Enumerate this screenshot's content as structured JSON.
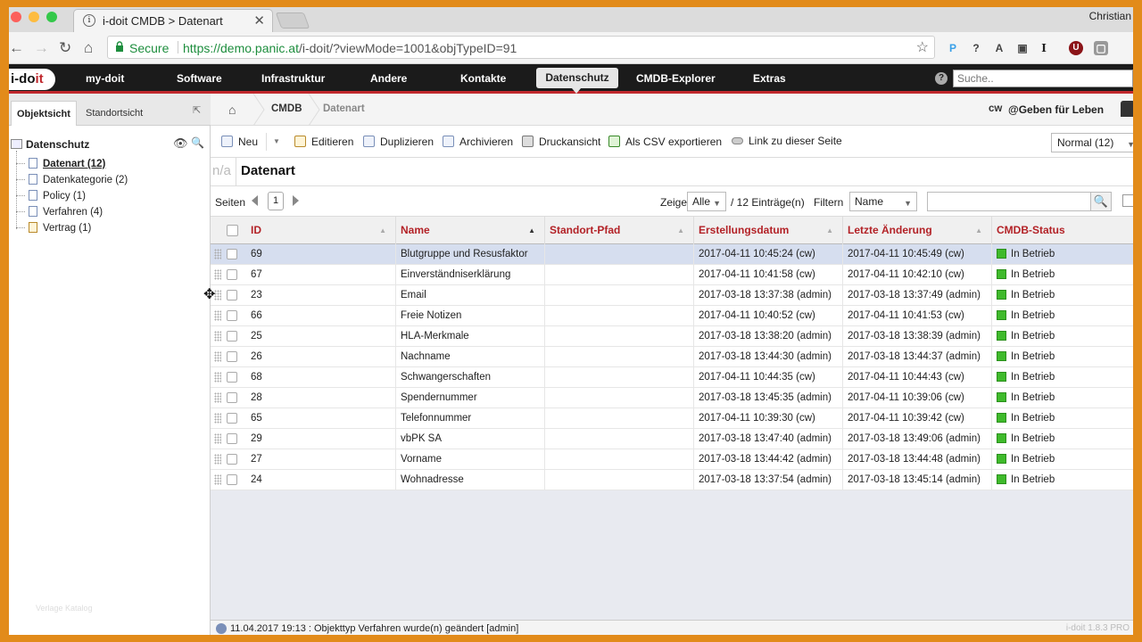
{
  "browser": {
    "tab_title": "i-doit CMDB > Datenart",
    "profile_name": "Christian",
    "secure_label": "Secure",
    "url_scheme_host": "https://demo.panic.at",
    "url_path": "/i-doit/?viewMode=1001&objTypeID=91",
    "favicon_glyph": "i",
    "close_glyph": "✕",
    "star_glyph": "☆",
    "extensions": [
      "P",
      "?",
      "A",
      "▣",
      "I",
      "U",
      "▢"
    ]
  },
  "topmenu": {
    "logo_main": "i-do",
    "logo_accent": "it",
    "items": [
      "my-doit",
      "Software",
      "Infrastruktur",
      "Andere",
      "Kontakte",
      "Datenschutz",
      "CMDB-Explorer",
      "Extras"
    ],
    "search_placeholder": "Suche..",
    "help_glyph": "?"
  },
  "left": {
    "tabs": [
      "Objektsicht",
      "Standortsicht"
    ],
    "root": "Datenschutz",
    "items": [
      "Datenart (12)",
      "Datenkategorie (2)",
      "Policy (1)",
      "Verfahren (4)",
      "Vertrag (1)"
    ],
    "footer": "Verlage Katalog"
  },
  "breadcrumb": {
    "items": [
      "CMDB",
      "Datenart"
    ],
    "user_short": "cw",
    "tenant": "@Geben für Leben"
  },
  "toolbar": {
    "new": "Neu",
    "edit": "Editieren",
    "duplicate": "Duplizieren",
    "archive": "Archivieren",
    "print": "Druckansicht",
    "csv": "Als CSV exportieren",
    "link": "Link zu dieser Seite",
    "view_select": "Normal (12)"
  },
  "page": {
    "na": "n/a",
    "title": "Datenart"
  },
  "pager": {
    "label": "Seiten",
    "current": "1",
    "show_label": "Zeige",
    "show_value": "Alle",
    "entries": "/ 12 Einträge(n)",
    "filter_label": "Filtern",
    "filter_field": "Name"
  },
  "table": {
    "columns": [
      "ID",
      "Name",
      "Standort-Pfad",
      "Erstellungsdatum",
      "Letzte Änderung",
      "CMDB-Status"
    ],
    "rows": [
      {
        "id": "69",
        "name": "Blutgruppe und Resusfaktor",
        "path": "",
        "created": "2017-04-11 10:45:24 (cw)",
        "changed": "2017-04-11 10:45:49 (cw)",
        "status": "In Betrieb"
      },
      {
        "id": "67",
        "name": "Einverständniserklärung",
        "path": "",
        "created": "2017-04-11 10:41:58 (cw)",
        "changed": "2017-04-11 10:42:10 (cw)",
        "status": "In Betrieb"
      },
      {
        "id": "23",
        "name": "Email",
        "path": "",
        "created": "2017-03-18 13:37:38 (admin)",
        "changed": "2017-03-18 13:37:49 (admin)",
        "status": "In Betrieb"
      },
      {
        "id": "66",
        "name": "Freie Notizen",
        "path": "",
        "created": "2017-04-11 10:40:52 (cw)",
        "changed": "2017-04-11 10:41:53 (cw)",
        "status": "In Betrieb"
      },
      {
        "id": "25",
        "name": "HLA-Merkmale",
        "path": "",
        "created": "2017-03-18 13:38:20 (admin)",
        "changed": "2017-03-18 13:38:39 (admin)",
        "status": "In Betrieb"
      },
      {
        "id": "26",
        "name": "Nachname",
        "path": "",
        "created": "2017-03-18 13:44:30 (admin)",
        "changed": "2017-03-18 13:44:37 (admin)",
        "status": "In Betrieb"
      },
      {
        "id": "68",
        "name": "Schwangerschaften",
        "path": "",
        "created": "2017-04-11 10:44:35 (cw)",
        "changed": "2017-04-11 10:44:43 (cw)",
        "status": "In Betrieb"
      },
      {
        "id": "28",
        "name": "Spendernummer",
        "path": "",
        "created": "2017-03-18 13:45:35 (admin)",
        "changed": "2017-04-11 10:39:06 (cw)",
        "status": "In Betrieb"
      },
      {
        "id": "65",
        "name": "Telefonnummer",
        "path": "",
        "created": "2017-04-11 10:39:30 (cw)",
        "changed": "2017-04-11 10:39:42 (cw)",
        "status": "In Betrieb"
      },
      {
        "id": "29",
        "name": "vbPK SA",
        "path": "",
        "created": "2017-03-18 13:47:40 (admin)",
        "changed": "2017-03-18 13:49:06 (admin)",
        "status": "In Betrieb"
      },
      {
        "id": "27",
        "name": "Vorname",
        "path": "",
        "created": "2017-03-18 13:44:42 (admin)",
        "changed": "2017-03-18 13:44:48 (admin)",
        "status": "In Betrieb"
      },
      {
        "id": "24",
        "name": "Wohnadresse",
        "path": "",
        "created": "2017-03-18 13:37:54 (admin)",
        "changed": "2017-03-18 13:45:14 (admin)",
        "status": "In Betrieb"
      }
    ]
  },
  "statusbar": {
    "text": "11.04.2017 19:13 : Objekttyp Verfahren wurde(n) geändert [admin]",
    "version": "i-doit 1.8.3 PRO"
  },
  "colors": {
    "accent_red": "#c0282d",
    "status_green": "#3fba2b",
    "menu_bg": "#1b1b1b",
    "row_highlight": "#d6deef"
  }
}
